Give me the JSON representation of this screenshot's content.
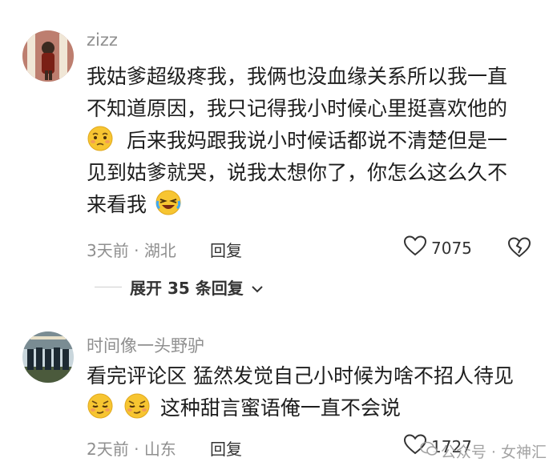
{
  "comments": [
    {
      "username": "zizz",
      "lines": [
        "我姑爹超级疼我，我俩也没血缘关系所以我一直",
        "不知道原因，我只记得我小时候心里挺喜欢他的",
        "后来我妈跟我说小时候话都说不清楚但是一",
        "见到姑爹就哭，说我太想你了，你怎么这么久不",
        "来看我"
      ],
      "emojis": [
        "shy-face-emoji",
        "crying-laughing-emoji"
      ],
      "time": "3天前",
      "sep": "·",
      "location": "湖北",
      "reply_label": "回复",
      "likes": "7075",
      "expand_label": "展开 35 条回复"
    },
    {
      "username": "时间像一头野驴",
      "lines": [
        "看完评论区 猛然发觉自己小时候为啥不招人待见",
        "这种甜言蜜语俺一直不会说"
      ],
      "emojis": [
        "smirk-face-emoji",
        "smirk-face-emoji"
      ],
      "time": "2天前",
      "sep": "·",
      "location": "山东",
      "reply_label": "回复",
      "likes": "1727"
    }
  ],
  "watermark": "公众号 · 女神汇",
  "colors": {
    "meta_gray": "#8f8f8f",
    "text": "#1e1e1e",
    "emoji_yellow": "#f7c531"
  }
}
